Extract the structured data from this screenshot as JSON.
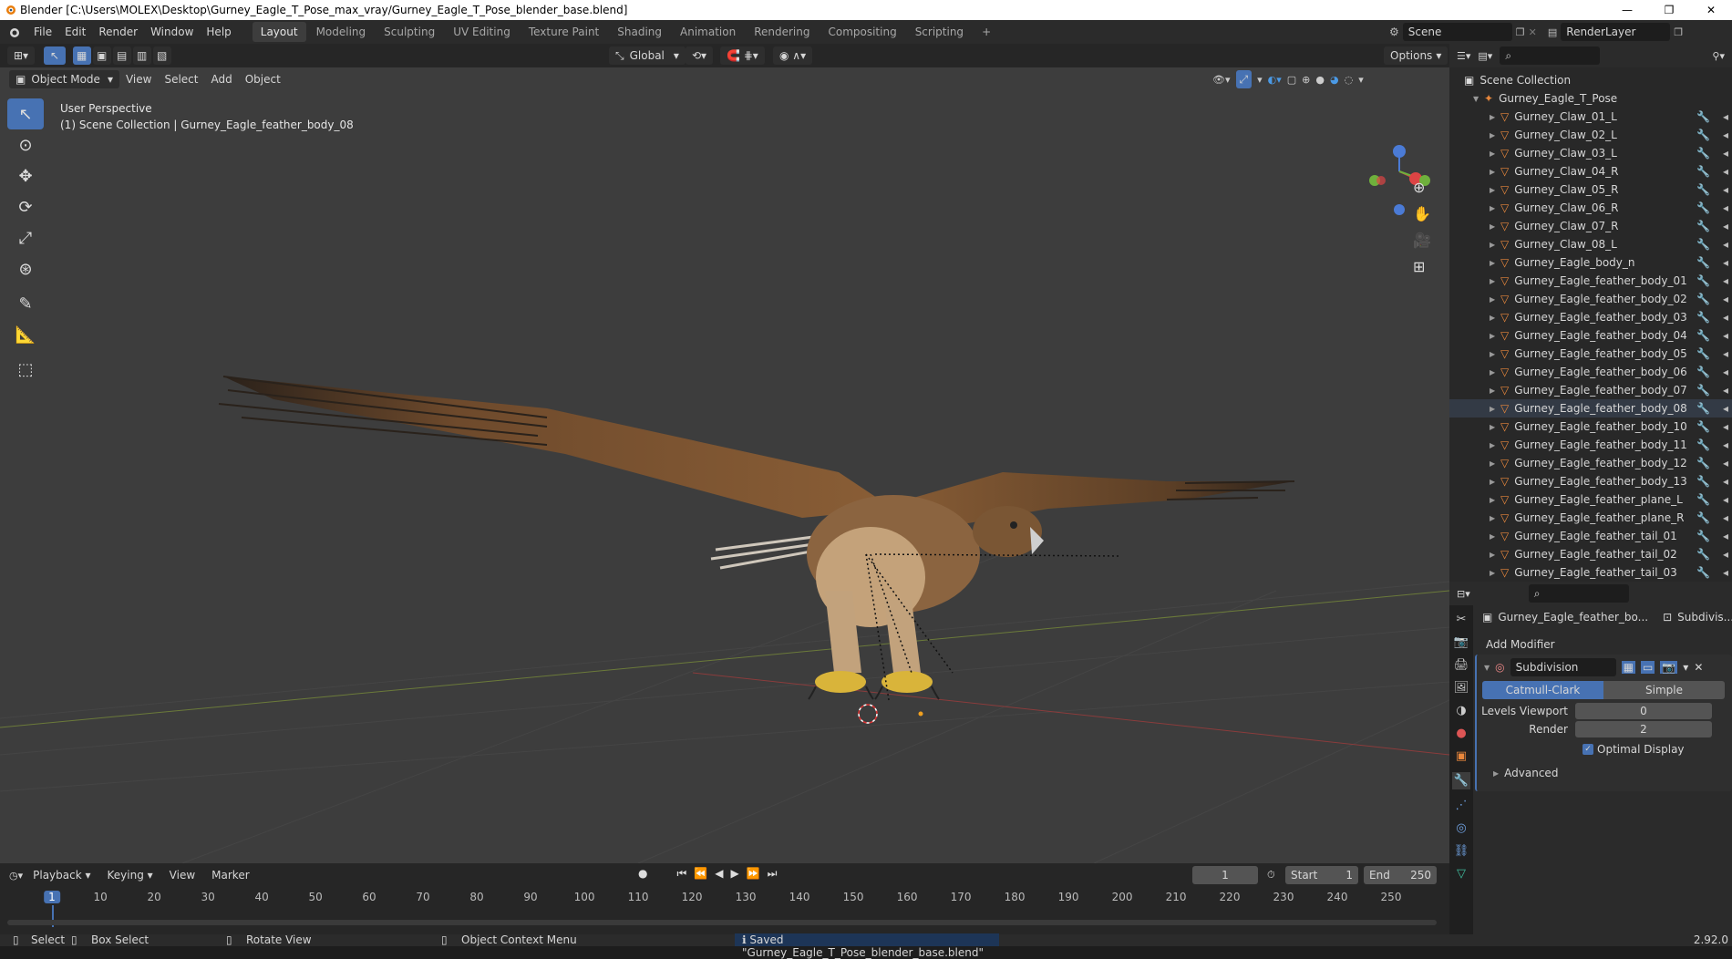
{
  "window": {
    "title": "Blender [C:\\Users\\MOLEX\\Desktop\\Gurney_Eagle_T_Pose_max_vray/Gurney_Eagle_T_Pose_blender_base.blend]",
    "minimize": "—",
    "maximize": "❐",
    "close": "✕"
  },
  "menubar": {
    "items": [
      "File",
      "Edit",
      "Render",
      "Window",
      "Help"
    ],
    "workspaces": [
      "Layout",
      "Modeling",
      "Sculpting",
      "UV Editing",
      "Texture Paint",
      "Shading",
      "Animation",
      "Rendering",
      "Compositing",
      "Scripting"
    ],
    "active_workspace": "Layout",
    "add_tab": "+",
    "scene": "Scene",
    "render_layer": "RenderLayer"
  },
  "viewport_header": {
    "transform_orientation": "Global",
    "options": "Options",
    "mode": "Object Mode",
    "menus": [
      "View",
      "Select",
      "Add",
      "Object"
    ]
  },
  "viewport": {
    "perspective": "User Perspective",
    "collection_info": "(1) Scene Collection | Gurney_Eagle_feather_body_08",
    "gizmo_z": "Z",
    "gizmo_x": "X",
    "gizmo_y": "Y"
  },
  "outliner": {
    "root": "Scene Collection",
    "collection": "Gurney_Eagle_T_Pose",
    "selected": "Gurney_Eagle_feather_body_08",
    "items": [
      "Gurney_Claw_01_L",
      "Gurney_Claw_02_L",
      "Gurney_Claw_03_L",
      "Gurney_Claw_04_R",
      "Gurney_Claw_05_R",
      "Gurney_Claw_06_R",
      "Gurney_Claw_07_R",
      "Gurney_Claw_08_L",
      "Gurney_Eagle_body_n",
      "Gurney_Eagle_feather_body_01",
      "Gurney_Eagle_feather_body_02",
      "Gurney_Eagle_feather_body_03",
      "Gurney_Eagle_feather_body_04",
      "Gurney_Eagle_feather_body_05",
      "Gurney_Eagle_feather_body_06",
      "Gurney_Eagle_feather_body_07",
      "Gurney_Eagle_feather_body_08",
      "Gurney_Eagle_feather_body_10",
      "Gurney_Eagle_feather_body_11",
      "Gurney_Eagle_feather_body_12",
      "Gurney_Eagle_feather_body_13",
      "Gurney_Eagle_feather_plane_L",
      "Gurney_Eagle_feather_plane_R",
      "Gurney_Eagle_feather_tail_01",
      "Gurney_Eagle_feather_tail_02",
      "Gurney_Eagle_feather_tail_03"
    ]
  },
  "properties": {
    "object_name": "Gurney_Eagle_feather_bo...",
    "modifier_tab": "Subdivis...",
    "add_modifier": "Add Modifier",
    "modifier_name": "Subdivision",
    "catmull": "Catmull-Clark",
    "simple": "Simple",
    "levels_viewport_label": "Levels Viewport",
    "levels_viewport": "0",
    "render_label": "Render",
    "render_value": "2",
    "optimal_display": "Optimal Display",
    "advanced": "Advanced"
  },
  "timeline": {
    "menus": [
      "Playback",
      "Keying",
      "View",
      "Marker"
    ],
    "current_frame": "1",
    "start_label": "Start",
    "start": "1",
    "end_label": "End",
    "end": "250",
    "ticks": [
      "1",
      "10",
      "20",
      "30",
      "40",
      "50",
      "60",
      "70",
      "80",
      "90",
      "100",
      "110",
      "120",
      "130",
      "140",
      "150",
      "160",
      "170",
      "180",
      "190",
      "200",
      "210",
      "220",
      "230",
      "240",
      "250"
    ]
  },
  "statusbar": {
    "select": "Select",
    "box_select": "Box Select",
    "rotate_view": "Rotate View",
    "context_menu": "Object Context Menu",
    "message": "Saved \"Gurney_Eagle_T_Pose_blender_base.blend\"",
    "version": "2.92.0"
  },
  "colors": {
    "accent": "#4772b3",
    "mesh_icon": "#e8873c",
    "modifier_icon": "#6fa0e0",
    "data_icon": "#3fbf9f"
  }
}
